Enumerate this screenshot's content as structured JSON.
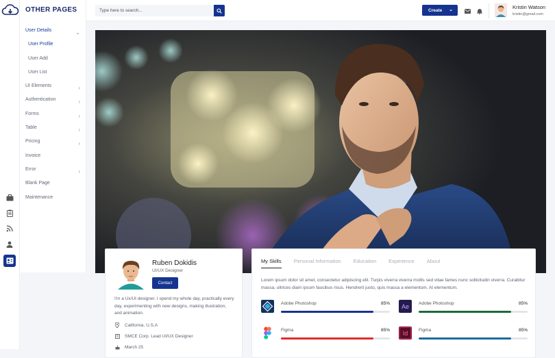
{
  "app": {
    "brand": "OTHER PAGES"
  },
  "search": {
    "placeholder": "Type here to search..."
  },
  "header": {
    "create_label": "Create",
    "user_name": "Kristin Watson",
    "user_email": "kristin@gmail.com"
  },
  "rail_icons": [
    "briefcase-icon",
    "clipboard-icon",
    "rss-icon",
    "user-icon",
    "id-card-icon"
  ],
  "sidebar": {
    "items": [
      {
        "label": "User Details",
        "expanded": true
      },
      {
        "label": "User Profile",
        "sub": true,
        "active": true
      },
      {
        "label": "User Add",
        "sub": true
      },
      {
        "label": "User List",
        "sub": true
      },
      {
        "label": "UI Elements",
        "chevron": true
      },
      {
        "label": "Authentication",
        "chevron": true
      },
      {
        "label": "Forms",
        "chevron": true
      },
      {
        "label": "Table",
        "chevron": true
      },
      {
        "label": "Pricing",
        "chevron": true
      },
      {
        "label": "Invoice"
      },
      {
        "label": "Error",
        "chevron": true
      },
      {
        "label": "Blank Page"
      },
      {
        "label": "Maintenance"
      }
    ]
  },
  "profile": {
    "name": "Ruben Dokidis",
    "role": "UI/UX Designer",
    "contact_label": "Contact",
    "bio": "I'm a Ux/UI designer. I spend my whole day, practically every day, experimenting with new designs, making illustration, and animation.",
    "location": "California, U.S.A",
    "company": "SMCE Corp. Lead UI/UX Designer",
    "birthday": "March 25"
  },
  "skills_card": {
    "tabs": [
      "My Skills",
      "Personal Information",
      "Education",
      "Experience",
      "About"
    ],
    "active_tab": 0,
    "intro": "Lorem ipsum dolor sit amet, consectetur adipiscing elit. Turpis viverra viverra mollis sed vitae fames nunc sollicitudin viverra. Curabitur massa, ultrices diam ipsum faucibus risus. Hendrerit justo, quis massa a elementum. At elementum.",
    "skills": [
      {
        "name": "Adobe Photoshop",
        "percent_label": "85%",
        "level": 0.85,
        "color": "#16348f",
        "icon": "photoshop-diamond-icon"
      },
      {
        "name": "Adobe Photoshop",
        "percent_label": "85%",
        "level": 0.85,
        "color": "#1a6b3a",
        "icon": "after-effects-icon",
        "icon_text": "Ae"
      },
      {
        "name": "Figma",
        "percent_label": "85%",
        "level": 0.85,
        "color": "#e32a2a",
        "icon": "figma-icon"
      },
      {
        "name": "Figma",
        "percent_label": "85%",
        "level": 0.85,
        "color": "#1d6a9a",
        "icon": "indesign-icon",
        "icon_text": "Id"
      }
    ]
  }
}
